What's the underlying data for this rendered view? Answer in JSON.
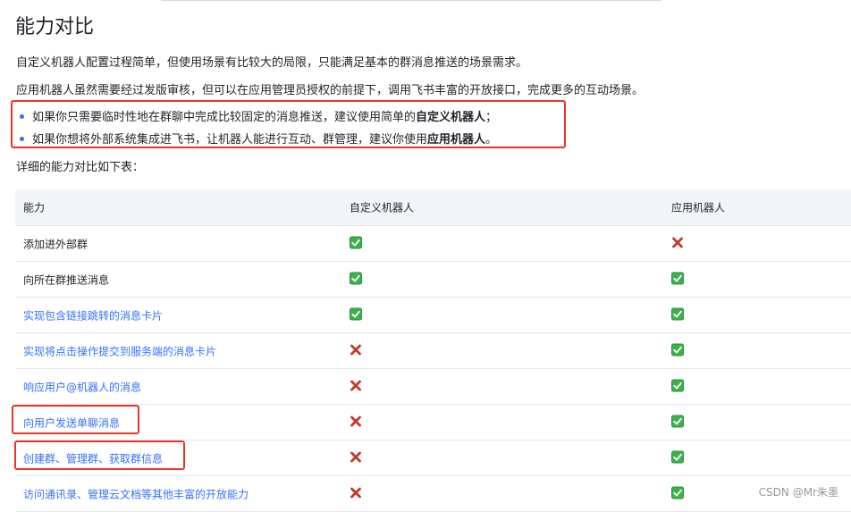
{
  "title": "能力对比",
  "intro": {
    "line1": "自定义机器人配置过程简单，但使用场景有比较大的局限，只能满足基本的群消息推送的场景需求。",
    "line2": "应用机器人虽然需要经过发版审核，但可以在应用管理员授权的前提下，调用飞书丰富的开放接口，完成更多的互动场景。"
  },
  "bullets": [
    {
      "text": "如果你只需要临时性地在群聊中完成比较固定的消息推送，建议使用简单的",
      "bold": "自定义机器人",
      "tail": "；"
    },
    {
      "text": "如果你想将外部系统集成进飞书，让机器人能进行互动、群管理，建议你使用",
      "bold": "应用机器人",
      "tail": "。"
    }
  ],
  "detail_intro": "详细的能力对比如下表：",
  "table": {
    "headers": [
      "能力",
      "自定义机器人",
      "应用机器人"
    ],
    "rows": [
      {
        "capability": "添加进外部群",
        "custom": "check",
        "app": "cross",
        "link": false
      },
      {
        "capability": "向所在群推送消息",
        "custom": "check",
        "app": "check",
        "link": false
      },
      {
        "capability": "实现包含链接跳转的消息卡片",
        "custom": "check",
        "app": "check",
        "link": true
      },
      {
        "capability": "实现将点击操作提交到服务端的消息卡片",
        "custom": "cross",
        "app": "check",
        "link": true
      },
      {
        "capability": "响应用户@机器人的消息",
        "custom": "cross",
        "app": "check",
        "link": true
      },
      {
        "capability": "向用户发送单聊消息",
        "custom": "cross",
        "app": "check",
        "link": true
      },
      {
        "capability": "创建群、管理群、获取群信息",
        "custom": "cross",
        "app": "check",
        "link": true
      },
      {
        "capability": "访问通讯录、管理云文档等其他丰富的开放能力",
        "custom": "cross",
        "app": "check",
        "link": true
      }
    ]
  },
  "icons": {
    "check": "green-check-icon",
    "cross": "red-cross-icon"
  },
  "colors": {
    "link": "#3370ff",
    "highlight_border": "#e8342c",
    "check_green": "#3bb34a",
    "cross_red": "#c0392b"
  },
  "watermark": "CSDN @Mr朱墨"
}
